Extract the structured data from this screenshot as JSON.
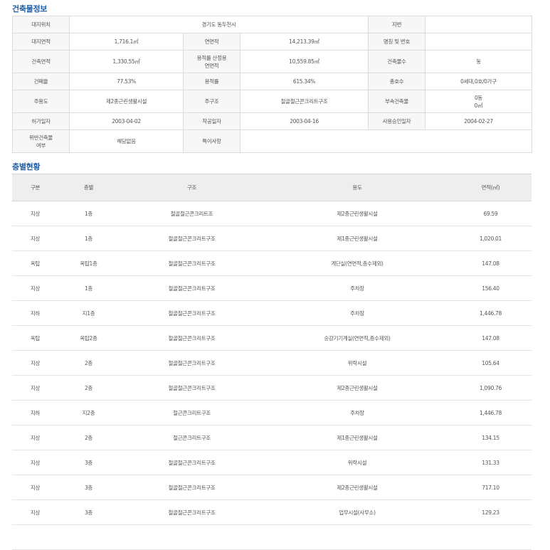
{
  "building": {
    "title": "건축물정보",
    "rows": [
      [
        {
          "t": "대지위치",
          "l": true
        },
        {
          "t": "경기도 동두천시",
          "l": false,
          "span": 3
        },
        {
          "t": "지번",
          "l": true
        },
        {
          "t": "",
          "l": false
        }
      ],
      [
        {
          "t": "대지면적",
          "l": true
        },
        {
          "t": "1,716.1㎡",
          "l": false
        },
        {
          "t": "연면적",
          "l": true
        },
        {
          "t": "14,213.39㎡",
          "l": false
        },
        {
          "t": "명칭 및 번호",
          "l": true
        },
        {
          "t": "",
          "l": false
        }
      ],
      [
        {
          "t": "건축면적",
          "l": true
        },
        {
          "t": "1,330.55㎡",
          "l": false
        },
        {
          "t": "용적률 산정용\n연면적",
          "l": true
        },
        {
          "t": "10,559.85㎡",
          "l": false
        },
        {
          "t": "건축물수",
          "l": true
        },
        {
          "t": "동",
          "l": false
        }
      ],
      [
        {
          "t": "건폐율",
          "l": true
        },
        {
          "t": "77.53%",
          "l": false
        },
        {
          "t": "용적률",
          "l": true
        },
        {
          "t": "615.34%",
          "l": false
        },
        {
          "t": "총호수",
          "l": true
        },
        {
          "t": "0세대,0호/0가구",
          "l": false
        }
      ],
      [
        {
          "t": "주용도",
          "l": true
        },
        {
          "t": "제2종근린생활시설",
          "l": false
        },
        {
          "t": "주구조",
          "l": true
        },
        {
          "t": "철골철근콘크리트구조",
          "l": false
        },
        {
          "t": "부속건축물",
          "l": true
        },
        {
          "t": "0동\n0㎡",
          "l": false
        }
      ],
      [
        {
          "t": "허가일자",
          "l": true
        },
        {
          "t": "2003-04-02",
          "l": false
        },
        {
          "t": "착공일자",
          "l": true
        },
        {
          "t": "2003-04-16",
          "l": false
        },
        {
          "t": "사용승인일자",
          "l": true
        },
        {
          "t": "2004-02-27",
          "l": false
        }
      ],
      [
        {
          "t": "위반건축물\n여부",
          "l": true
        },
        {
          "t": "해당없음",
          "l": false
        },
        {
          "t": "특이사항",
          "l": true
        },
        {
          "t": "",
          "l": false,
          "span": 3
        }
      ]
    ]
  },
  "floors": {
    "title": "층별현황",
    "headers": [
      "구분",
      "층별",
      "구조",
      "용도",
      "면적(㎡)"
    ],
    "rows": [
      [
        "지상",
        "1층",
        "철골철근콘크리트조",
        "제2종근린생활시설",
        "69.59"
      ],
      [
        "지상",
        "1층",
        "철골철근콘크리트구조",
        "제1종근린생활시설",
        "1,020.01"
      ],
      [
        "옥탑",
        "옥탑1층",
        "철골철근콘크리트구조",
        "계단실(연면적,층수제외)",
        "147.08"
      ],
      [
        "지상",
        "1층",
        "철골철근콘크리트구조",
        "주차장",
        "156.40"
      ],
      [
        "지하",
        "지1층",
        "철골철근콘크리트구조",
        "주차장",
        "1,446.78"
      ],
      [
        "옥탑",
        "옥탑2층",
        "철골철근콘크리트구조",
        "승강기기계실(연면적,층수제외)",
        "147.08"
      ],
      [
        "지상",
        "2층",
        "철골철근콘크리트구조",
        "위락시설",
        "105.64"
      ],
      [
        "지상",
        "2층",
        "철골철근콘크리트구조",
        "제2종근린생활시설",
        "1,090.76"
      ],
      [
        "지하",
        "지2층",
        "철근콘크리트구조",
        "주차장",
        "1,446.78"
      ],
      [
        "지상",
        "2층",
        "철근콘크리트구조",
        "제1종근린생활시설",
        "134.15"
      ],
      [
        "지상",
        "3층",
        "철골철근콘크리트구조",
        "위락시설",
        "131.33"
      ],
      [
        "지상",
        "3층",
        "철골철근콘크리트구조",
        "제2종근린생활시설",
        "717.10"
      ],
      [
        "지상",
        "3층",
        "철골철근콘크리트구조",
        "업무시설(사무소)",
        "129.23"
      ],
      [
        "",
        "",
        "",
        "",
        ""
      ]
    ]
  }
}
